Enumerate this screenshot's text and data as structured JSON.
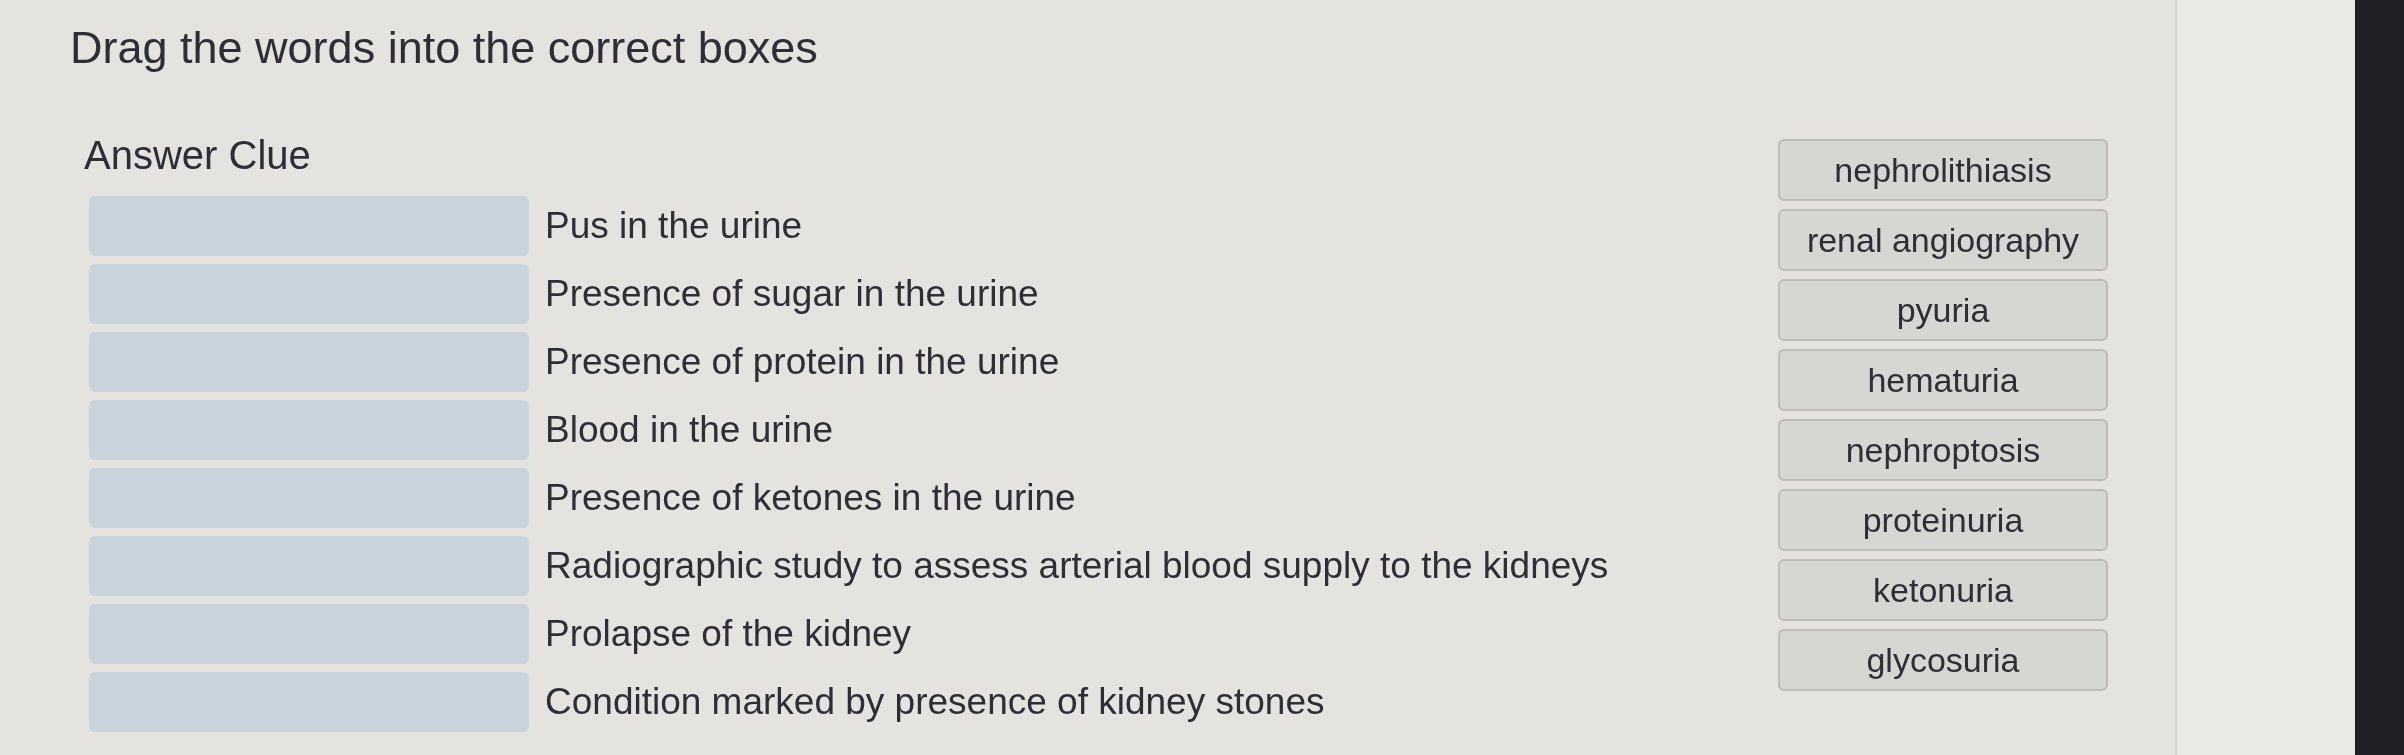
{
  "title": "Drag the words into the correct boxes",
  "header": "Answer Clue",
  "clues": [
    "Pus in the urine",
    "Presence of sugar in the urine",
    "Presence of protein in the urine",
    "Blood in the urine",
    "Presence of ketones in the urine",
    "Radiographic study to assess arterial blood supply to the kidneys",
    "Prolapse of the kidney",
    "Condition marked by presence of kidney stones"
  ],
  "word_bank": [
    "nephrolithiasis",
    "renal angiography",
    "pyuria",
    "hematuria",
    "nephroptosis",
    "proteinuria",
    "ketonuria",
    "glycosuria"
  ]
}
